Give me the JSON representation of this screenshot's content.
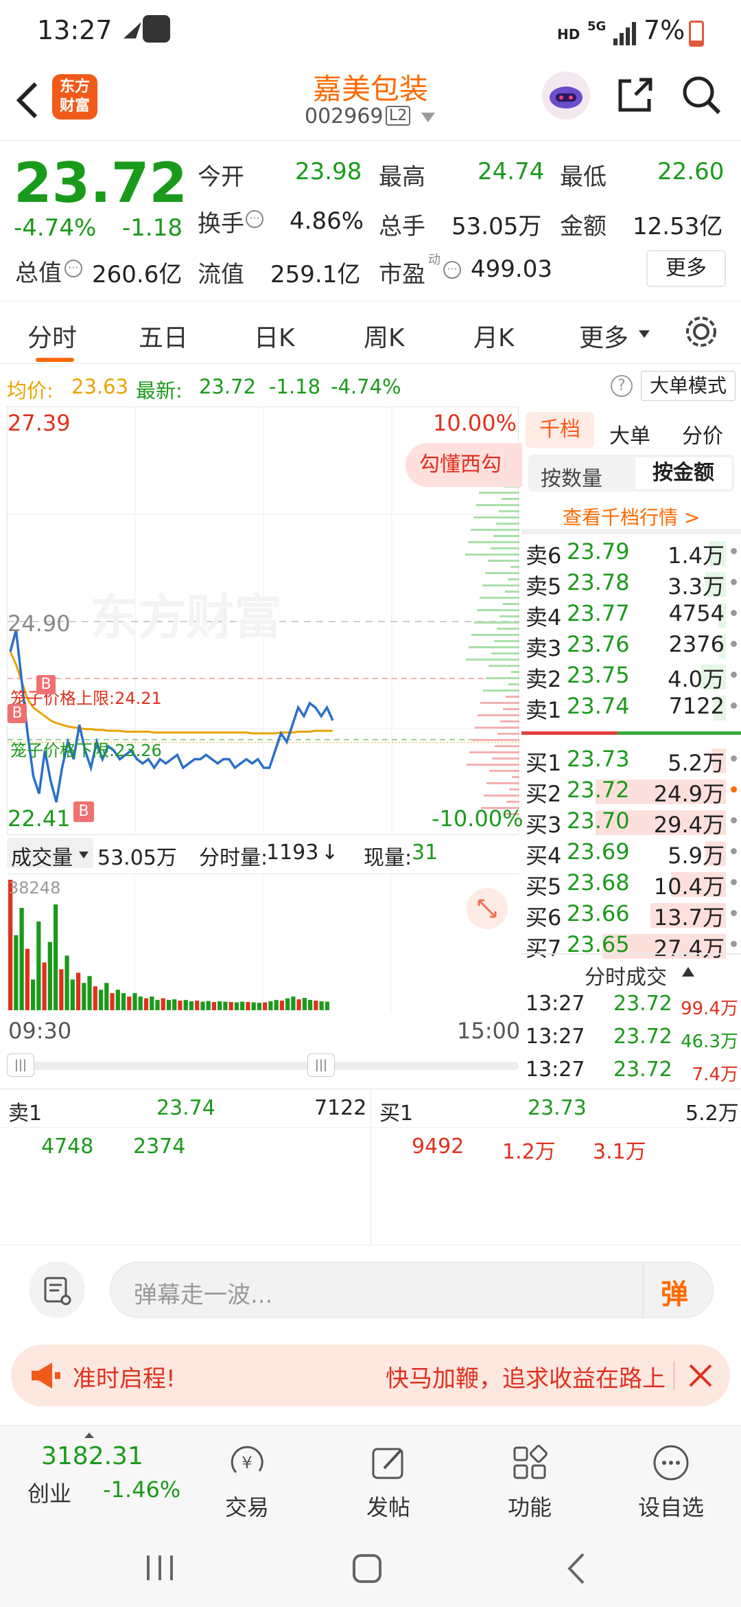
{
  "status_bar": {
    "time": "13:27",
    "network": "HD",
    "net_type": "5G",
    "battery": "7%"
  },
  "header": {
    "title": "嘉美包装",
    "code": "002969",
    "level_badge": "L2",
    "logo_text_1": "东方",
    "logo_text_2": "财富",
    "icons": [
      "back-icon",
      "robot-avatar-icon",
      "share-icon",
      "search-icon"
    ]
  },
  "quote": {
    "price": "23.72",
    "change_pct": "-4.74%",
    "change": "-1.18",
    "open_label": "今开",
    "open": "23.98",
    "high_label": "最高",
    "high": "24.74",
    "low_label": "最低",
    "low": "22.60",
    "turnover_label": "换手",
    "turnover": "4.86%",
    "volume_label": "总手",
    "volume": "53.05万",
    "amount_label": "金额",
    "amount": "12.53亿",
    "mktcap_label": "总值",
    "mktcap": "260.6亿",
    "float_label": "流值",
    "float": "259.1亿",
    "pe_label": "市盈",
    "pe_sup": "动",
    "pe": "499.03",
    "more_label": "更多"
  },
  "tabs": [
    "分时",
    "五日",
    "日K",
    "周K",
    "月K",
    "更多"
  ],
  "avg_bar": {
    "avg_label": "均价:",
    "avg": "23.63",
    "latest_label": "最新:",
    "latest": "23.72",
    "change": "-1.18",
    "pct": "-4.74%",
    "mode_button": "大单模式"
  },
  "chart": {
    "y_top": "27.39",
    "y_bottom": "22.41",
    "pct_top": "10.00%",
    "pct_bottom": "-10.00%",
    "prev_close": "24.90",
    "watermark": "东方财富",
    "promo_tag": "勾懂西勾",
    "upper_limit_label": "笼子价格上限:",
    "upper_limit": "24.21",
    "lower_limit_label": "笼子价格下限:",
    "lower_limit": "23.26",
    "marker_b": "B"
  },
  "chart_data": {
    "type": "line",
    "ylim": [
      22.41,
      27.39
    ],
    "series": [
      {
        "values": [
          24.55,
          24.8,
          24.2,
          23.6,
          23.1,
          22.9,
          23.4,
          23.05,
          22.8,
          23.2,
          23.5,
          23.3,
          23.7,
          23.4,
          23.2,
          23.5,
          23.3,
          23.45,
          23.4,
          23.3,
          23.35,
          23.4,
          23.3,
          23.25,
          23.3,
          23.2,
          23.3,
          23.25,
          23.3,
          23.35,
          23.2,
          23.25,
          23.3,
          23.3,
          23.35,
          23.3,
          23.25,
          23.3,
          23.3,
          23.2,
          23.25,
          23.3,
          23.25,
          23.3,
          23.2,
          23.2,
          23.4,
          23.6,
          23.5,
          23.7,
          23.9,
          23.8,
          23.95,
          23.9,
          23.8,
          23.9,
          23.75
        ],
        "color": "#2a6fc9"
      },
      {
        "values": [
          24.55,
          24.4,
          24.2,
          24.0,
          23.9,
          23.85,
          23.8,
          23.75,
          23.72,
          23.7,
          23.68,
          23.67,
          23.66,
          23.65,
          23.65,
          23.64,
          23.64,
          23.63,
          23.63,
          23.63,
          23.62,
          23.62,
          23.62,
          23.62,
          23.62,
          23.61,
          23.61,
          23.61,
          23.61,
          23.61,
          23.61,
          23.61,
          23.61,
          23.61,
          23.61,
          23.61,
          23.61,
          23.61,
          23.61,
          23.61,
          23.61,
          23.61,
          23.6,
          23.6,
          23.6,
          23.6,
          23.6,
          23.61,
          23.61,
          23.61,
          23.62,
          23.62,
          23.62,
          23.63,
          23.63,
          23.63,
          23.63
        ],
        "color": "#e8a400"
      }
    ],
    "volume": {
      "max_label": "38248",
      "values": [
        38248,
        22000,
        30000,
        18000,
        9000,
        26000,
        14000,
        20000,
        31000,
        12000,
        16000,
        9000,
        11000,
        8000,
        10000,
        7000,
        6000,
        8000,
        5000,
        6000,
        5000,
        4000,
        5000,
        4000,
        3500,
        4000,
        3000,
        3500,
        3000,
        3200,
        2800,
        3000,
        2600,
        2800,
        2500,
        2700,
        2400,
        2600,
        2500,
        2400,
        2300,
        2500,
        2400,
        2300,
        2200,
        2300,
        2600,
        3000,
        2800,
        3500,
        4000,
        3200,
        3600,
        3000,
        2800,
        2600,
        2500
      ]
    }
  },
  "volume_bar": {
    "label": "成交量",
    "total": "53.05万",
    "minute_label": "分时量:",
    "minute": "1193",
    "arrow": "↓",
    "current_label": "现量:",
    "current": "31"
  },
  "time_axis": {
    "start": "09:30",
    "end": "15:00"
  },
  "side": {
    "tabs": [
      "千档",
      "大单",
      "分价"
    ],
    "sub_tabs": [
      "按数量",
      "按金额"
    ],
    "link": "查看千档行情 >",
    "asks": [
      {
        "label": "卖6",
        "price": "23.79",
        "vol": "1.4万"
      },
      {
        "label": "卖5",
        "price": "23.78",
        "vol": "3.3万"
      },
      {
        "label": "卖4",
        "price": "23.77",
        "vol": "4754"
      },
      {
        "label": "卖3",
        "price": "23.76",
        "vol": "2376"
      },
      {
        "label": "卖2",
        "price": "23.75",
        "vol": "4.0万"
      },
      {
        "label": "卖1",
        "price": "23.74",
        "vol": "7122"
      }
    ],
    "bids": [
      {
        "label": "买1",
        "price": "23.73",
        "vol": "5.2万"
      },
      {
        "label": "买2",
        "price": "23.72",
        "vol": "24.9万"
      },
      {
        "label": "买3",
        "price": "23.70",
        "vol": "29.4万"
      },
      {
        "label": "买4",
        "price": "23.69",
        "vol": "5.9万"
      },
      {
        "label": "买5",
        "price": "23.68",
        "vol": "10.4万"
      },
      {
        "label": "买6",
        "price": "23.66",
        "vol": "13.7万"
      },
      {
        "label": "买7",
        "price": "23.65",
        "vol": "27.4万"
      }
    ],
    "trades_title": "分时成交",
    "trades": [
      {
        "time": "13:27",
        "price": "23.72",
        "vol": "99.4万"
      },
      {
        "time": "13:27",
        "price": "23.72",
        "vol": "46.3万"
      },
      {
        "time": "13:27",
        "price": "23.72",
        "vol": "7.4万"
      }
    ]
  },
  "book": {
    "ask_label": "卖1",
    "ask_price": "23.74",
    "ask_vol": "7122",
    "ask_q1": "4748",
    "ask_q2": "2374",
    "bid_label": "买1",
    "bid_price": "23.73",
    "bid_vol": "5.2万",
    "bid_q1": "9492",
    "bid_q2": "1.2万",
    "bid_q3": "3.1万"
  },
  "comment": {
    "placeholder": "弹幕走一波...",
    "send_label": "弹"
  },
  "banner": {
    "text_left": "准时启程!",
    "text_right": "快马加鞭，追求收益在路上"
  },
  "bottom_nav": {
    "index_value": "3182.31",
    "index_name": "创业",
    "index_pct": "-1.46%",
    "items": [
      "交易",
      "发帖",
      "功能",
      "设自选"
    ]
  }
}
